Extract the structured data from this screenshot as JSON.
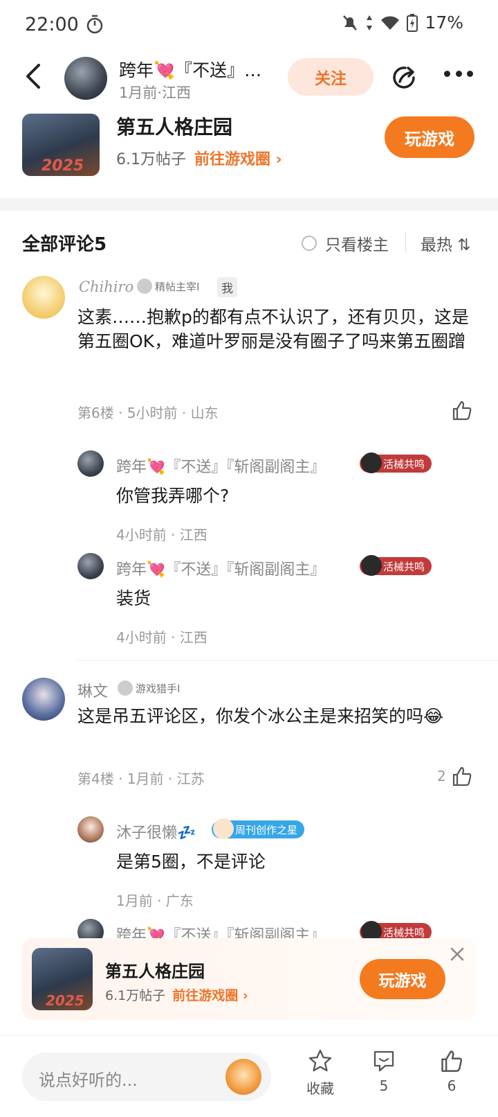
{
  "status": {
    "time": "22:00",
    "battery": "17%"
  },
  "header": {
    "title": "跨年💘『不送』…",
    "subtitle": "1月前·江西",
    "follow_label": "关注"
  },
  "game": {
    "name": "第五人格庄园",
    "thumb_year": "2025",
    "posts": "6.1万帖子",
    "link": "前往游戏圈 ›",
    "play_label": "玩游戏"
  },
  "comments_bar": {
    "title": "全部评论5",
    "only_op": "只看楼主",
    "sort": "最热 ⇅"
  },
  "comments": [
    {
      "name": "Chihiro",
      "badge": "精帖主宰I",
      "me_tag": "我",
      "text": "这素……抱歉p的都有点不认识了，还有贝贝，这是第五圈OK，难道叶罗丽是没有圈子了吗来第五圈蹭",
      "meta": "第6楼 · 5小时前 · 山东",
      "likes": "",
      "replies": [
        {
          "name": "跨年💘『不送』『斩阁副阁主』",
          "medal": "活械共鸣",
          "text": "你管我弄哪个?",
          "meta": "4小时前 · 江西"
        },
        {
          "name": "跨年💘『不送』『斩阁副阁主』",
          "medal": "活械共鸣",
          "text": "装货",
          "meta": "4小时前 · 江西"
        }
      ]
    },
    {
      "name": "琳文",
      "badge": "游戏猎手I",
      "text": "这是吊五评论区，你发个冰公主是来招笑的吗😂",
      "meta": "第4楼 · 1月前 · 江苏",
      "likes": "2",
      "replies": [
        {
          "name": "沐子很懒💤",
          "medal": "周刊创作之星",
          "text": "是第5圈，不是评论",
          "meta": "1月前 · 广东"
        },
        {
          "name": "跨年💘『不送』『斩阁副阁主』",
          "medal": "活械共鸣"
        }
      ]
    }
  ],
  "bottom": {
    "placeholder": "说点好听的...",
    "fav_label": "收藏",
    "comment_count": "5",
    "like_count": "6"
  }
}
